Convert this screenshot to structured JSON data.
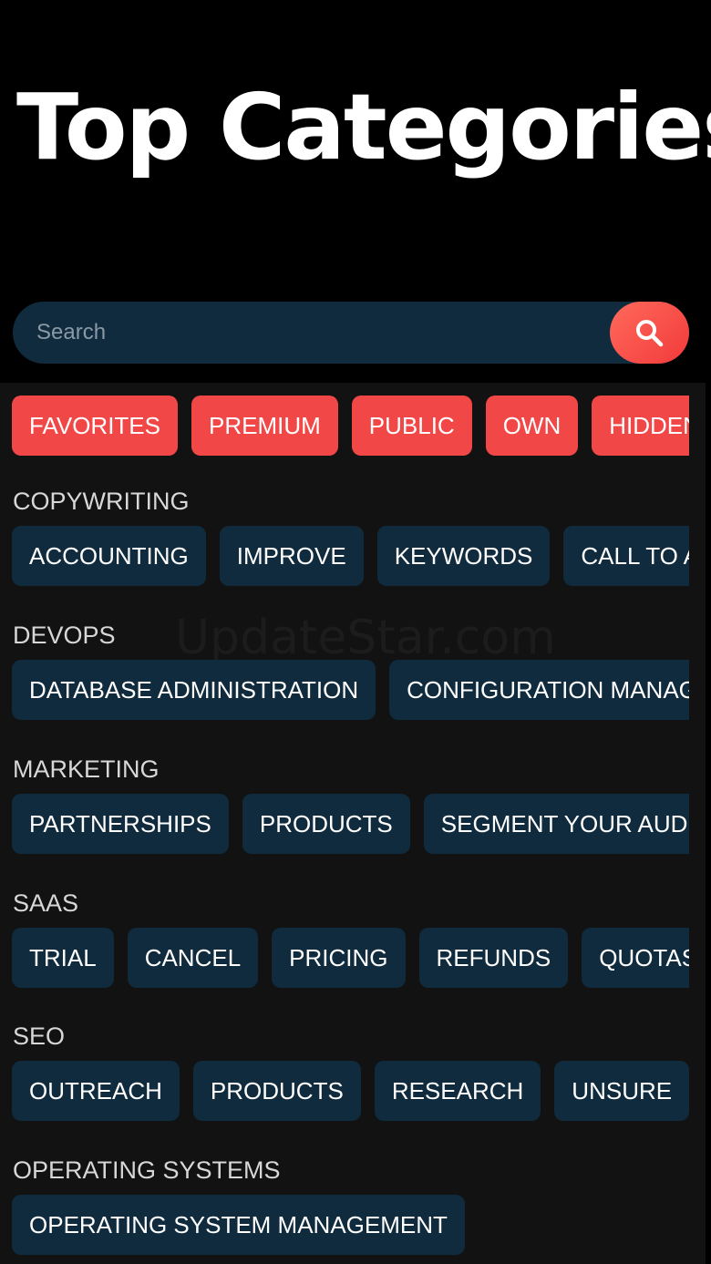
{
  "header": {
    "title": "Top Categories"
  },
  "search": {
    "placeholder": "Search",
    "button_icon": "search-icon"
  },
  "filters": [
    "FAVORITES",
    "PREMIUM",
    "PUBLIC",
    "OWN",
    "HIDDEN"
  ],
  "watermark": "UpdateStar.com",
  "categories": [
    {
      "name": "COPYWRITING",
      "tags": [
        "ACCOUNTING",
        "IMPROVE",
        "KEYWORDS",
        "CALL TO ACTION"
      ]
    },
    {
      "name": "DEVOPS",
      "tags": [
        "DATABASE ADMINISTRATION",
        "CONFIGURATION MANAGEMENT"
      ]
    },
    {
      "name": "MARKETING",
      "tags": [
        "PARTNERSHIPS",
        "PRODUCTS",
        "SEGMENT YOUR AUDIENCE"
      ]
    },
    {
      "name": "SAAS",
      "tags": [
        "TRIAL",
        "CANCEL",
        "PRICING",
        "REFUNDS",
        "QUOTAS"
      ]
    },
    {
      "name": "SEO",
      "tags": [
        "OUTREACH",
        "PRODUCTS",
        "RESEARCH",
        "UNSURE"
      ]
    },
    {
      "name": "OPERATING SYSTEMS",
      "tags": [
        "OPERATING SYSTEM MANAGEMENT"
      ]
    }
  ],
  "colors": {
    "background": "#000000",
    "panel": "#121212",
    "accent": "#f24747",
    "chip": "#0f2b3d"
  }
}
